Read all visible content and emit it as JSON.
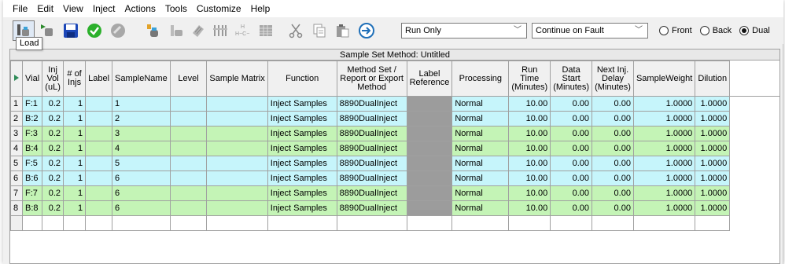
{
  "menu": [
    "File",
    "Edit",
    "View",
    "Inject",
    "Actions",
    "Tools",
    "Customize",
    "Help"
  ],
  "toolbar": {
    "icons": [
      "load-icon",
      "run-icon",
      "save-icon",
      "start-icon",
      "stop-icon",
      "vial-icon",
      "bottle-icon",
      "tray-icon",
      "columns-icon",
      "molecule-icon",
      "grid-icon",
      "cut-icon",
      "copy-icon",
      "paste-icon",
      "export-icon"
    ],
    "run_mode": "Run Only",
    "fault_mode": "Continue on Fault",
    "radio": [
      {
        "label": "Front",
        "checked": false
      },
      {
        "label": "Back",
        "checked": false
      },
      {
        "label": "Dual",
        "checked": true
      }
    ]
  },
  "tooltip": "Load",
  "grid": {
    "caption": "Sample Set Method: Untitled",
    "headers": [
      "Vial",
      "Inj Vol (uL)",
      "# of Injs",
      "Label",
      "SampleName",
      "Level",
      "Sample Matrix",
      "Function",
      "Method Set / Report or Export Method",
      "Label Reference",
      "Processing",
      "Run Time (Minutes)",
      "Data Start (Minutes)",
      "Next Inj. Delay (Minutes)",
      "SampleWeight",
      "Dilution"
    ],
    "rows": [
      {
        "n": "1",
        "vial": "F:1",
        "injvol": "0.2",
        "injs": "1",
        "label": "",
        "name": "1",
        "level": "",
        "matrix": "",
        "func": "Inject Samples",
        "method": "8890DualInject",
        "proc": "Normal",
        "runtime": "10.00",
        "datastart": "0.00",
        "delay": "0.00",
        "weight": "1.0000",
        "dilution": "1.0000"
      },
      {
        "n": "2",
        "vial": "B:2",
        "injvol": "0.2",
        "injs": "1",
        "label": "",
        "name": "2",
        "level": "",
        "matrix": "",
        "func": "Inject Samples",
        "method": "8890DualInject",
        "proc": "Normal",
        "runtime": "10.00",
        "datastart": "0.00",
        "delay": "0.00",
        "weight": "1.0000",
        "dilution": "1.0000"
      },
      {
        "n": "3",
        "vial": "F:3",
        "injvol": "0.2",
        "injs": "1",
        "label": "",
        "name": "3",
        "level": "",
        "matrix": "",
        "func": "Inject Samples",
        "method": "8890DualInject",
        "proc": "Normal",
        "runtime": "10.00",
        "datastart": "0.00",
        "delay": "0.00",
        "weight": "1.0000",
        "dilution": "1.0000"
      },
      {
        "n": "4",
        "vial": "B:4",
        "injvol": "0.2",
        "injs": "1",
        "label": "",
        "name": "4",
        "level": "",
        "matrix": "",
        "func": "Inject Samples",
        "method": "8890DualInject",
        "proc": "Normal",
        "runtime": "10.00",
        "datastart": "0.00",
        "delay": "0.00",
        "weight": "1.0000",
        "dilution": "1.0000"
      },
      {
        "n": "5",
        "vial": "F:5",
        "injvol": "0.2",
        "injs": "1",
        "label": "",
        "name": "5",
        "level": "",
        "matrix": "",
        "func": "Inject Samples",
        "method": "8890DualInject",
        "proc": "Normal",
        "runtime": "10.00",
        "datastart": "0.00",
        "delay": "0.00",
        "weight": "1.0000",
        "dilution": "1.0000"
      },
      {
        "n": "6",
        "vial": "B:6",
        "injvol": "0.2",
        "injs": "1",
        "label": "",
        "name": "6",
        "level": "",
        "matrix": "",
        "func": "Inject Samples",
        "method": "8890DualInject",
        "proc": "Normal",
        "runtime": "10.00",
        "datastart": "0.00",
        "delay": "0.00",
        "weight": "1.0000",
        "dilution": "1.0000"
      },
      {
        "n": "7",
        "vial": "F:7",
        "injvol": "0.2",
        "injs": "1",
        "label": "",
        "name": "6",
        "level": "",
        "matrix": "",
        "func": "Inject Samples",
        "method": "8890DualInject",
        "proc": "Normal",
        "runtime": "10.00",
        "datastart": "0.00",
        "delay": "0.00",
        "weight": "1.0000",
        "dilution": "1.0000"
      },
      {
        "n": "8",
        "vial": "B:8",
        "injvol": "0.2",
        "injs": "1",
        "label": "",
        "name": "6",
        "level": "",
        "matrix": "",
        "func": "Inject Samples",
        "method": "8890DualInject",
        "proc": "Normal",
        "runtime": "10.00",
        "datastart": "0.00",
        "delay": "0.00",
        "weight": "1.0000",
        "dilution": "1.0000"
      }
    ]
  },
  "colors": {
    "row_blue": "#c6f5fb",
    "row_green": "#c4f4b6",
    "label_ref": "#9c9c9c"
  }
}
